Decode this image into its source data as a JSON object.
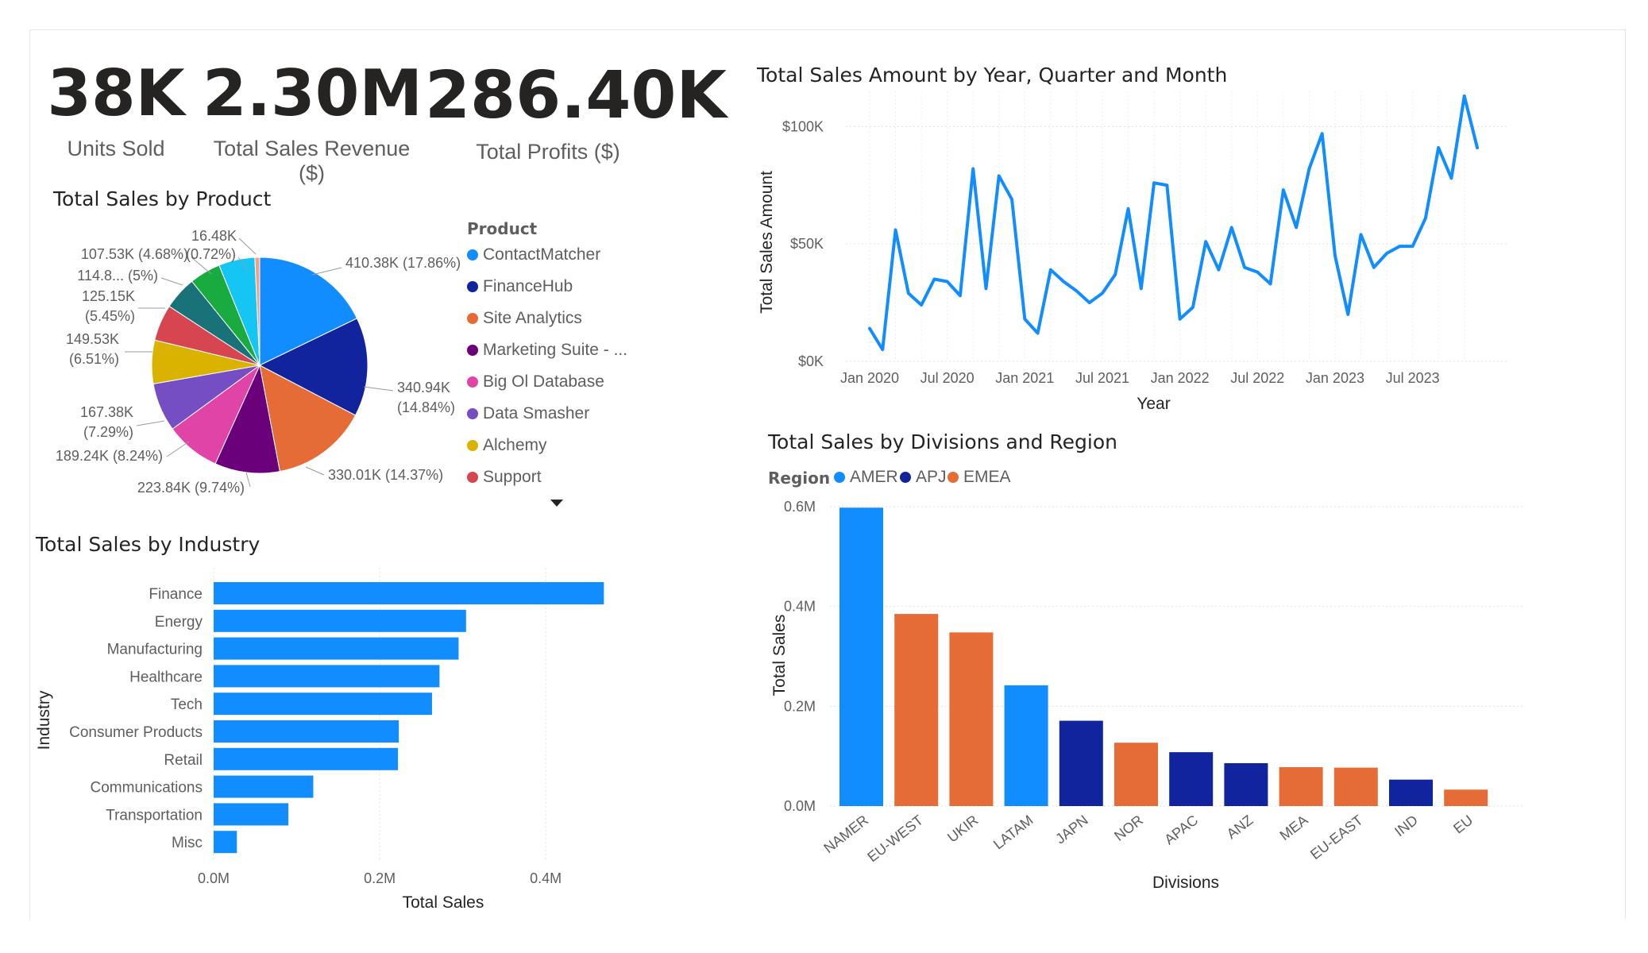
{
  "kpis": [
    {
      "value": "38K",
      "label": "Units Sold"
    },
    {
      "value": "2.30M",
      "label": "Total Sales Revenue ($)"
    },
    {
      "value": "286.40K",
      "label": "Total Profits ($)"
    }
  ],
  "colors": {
    "blue": "#118DFF",
    "navy": "#12239E",
    "orange": "#E66C37",
    "purple": "#6B007B",
    "pink": "#E044A7",
    "violet": "#744EC2",
    "yellow": "#D9B300",
    "red": "#D64550",
    "teal": "#197278",
    "green": "#1AAB40",
    "cyan": "#15C6F4",
    "salmon": "#F5A080"
  },
  "product_legend": {
    "title": "Product",
    "items": [
      {
        "label": "ContactMatcher",
        "color": "#118DFF"
      },
      {
        "label": "FinanceHub",
        "color": "#12239E"
      },
      {
        "label": "Site Analytics",
        "color": "#E66C37"
      },
      {
        "label": "Marketing Suite - ...",
        "color": "#6B007B"
      },
      {
        "label": "Big Ol Database",
        "color": "#E044A7"
      },
      {
        "label": "Data Smasher",
        "color": "#744EC2"
      },
      {
        "label": "Alchemy",
        "color": "#D9B300"
      },
      {
        "label": "Support",
        "color": "#D64550"
      }
    ]
  },
  "region_legend": {
    "title": "Region",
    "items": [
      {
        "label": "AMER",
        "color": "#118DFF"
      },
      {
        "label": "APJ",
        "color": "#12239E"
      },
      {
        "label": "EMEA",
        "color": "#E66C37"
      }
    ]
  },
  "chart_data": [
    {
      "type": "pie",
      "title": "Total Sales by Product",
      "values": [
        410.38,
        340.94,
        330.01,
        223.84,
        189.24,
        167.38,
        149.53,
        125.15,
        114.8,
        107.53,
        16.48
      ],
      "colors": [
        "#118DFF",
        "#12239E",
        "#E66C37",
        "#6B007B",
        "#E044A7",
        "#744EC2",
        "#D9B300",
        "#D64550",
        "#197278",
        "#1AAB40",
        "#15C6F4",
        "#F5A080"
      ],
      "labels": [
        {
          "lines": [
            "410.38K (17.86%)"
          ]
        },
        {
          "lines": [
            "340.94K",
            "(14.84%)"
          ]
        },
        {
          "lines": [
            "330.01K (14.37%)"
          ]
        },
        {
          "lines": [
            "223.84K (9.74%)"
          ]
        },
        {
          "lines": [
            "189.24K (8.24%)"
          ]
        },
        {
          "lines": [
            "167.38K",
            "(7.29%)"
          ]
        },
        {
          "lines": [
            "149.53K",
            "(6.51%)"
          ]
        },
        {
          "lines": [
            "125.15K",
            "(5.45%)"
          ]
        },
        {
          "lines": [
            "114.8... (5%)"
          ]
        },
        {
          "lines": [
            "107.53K (4.68%)"
          ]
        },
        {
          "lines": [
            "(0.72%)"
          ]
        },
        {
          "lines": [
            "16.48K"
          ]
        }
      ]
    },
    {
      "type": "line",
      "title": "Total Sales Amount by Year, Quarter and Month",
      "xlabel": "Year",
      "ylabel": "Total Sales Amount",
      "x_ticks": [
        "Jan 2020",
        "Jul 2020",
        "Jan 2021",
        "Jul 2021",
        "Jan 2022",
        "Jul 2022",
        "Jan 2023",
        "Jul 2023"
      ],
      "y_ticks": [
        "$0K",
        "$50K",
        "$100K"
      ],
      "ylim": [
        0,
        115000
      ],
      "x_start": "Jan 2020",
      "values": [
        14000,
        5000,
        56000,
        29000,
        24000,
        35000,
        34000,
        28000,
        82000,
        31000,
        79000,
        69000,
        18000,
        12000,
        39000,
        34000,
        30000,
        25000,
        29000,
        37000,
        65000,
        31000,
        76000,
        75000,
        18000,
        23000,
        51000,
        39000,
        57000,
        40000,
        38000,
        33000,
        73000,
        57000,
        82000,
        97000,
        45000,
        20000,
        54000,
        40000,
        46000,
        49000,
        49000,
        61000,
        91000,
        78000,
        113000,
        91000
      ],
      "color": "#118DFF"
    },
    {
      "type": "bar",
      "orientation": "horizontal",
      "title": "Total Sales by Industry",
      "xlabel": "Total Sales",
      "ylabel": "Industry",
      "categories": [
        "Finance",
        "Energy",
        "Manufacturing",
        "Healthcare",
        "Tech",
        "Consumer Products",
        "Retail",
        "Communications",
        "Transportation",
        "Misc"
      ],
      "values": [
        0.47,
        0.304,
        0.295,
        0.272,
        0.263,
        0.223,
        0.222,
        0.12,
        0.09,
        0.028
      ],
      "x_ticks": [
        "0.0M",
        "0.2M",
        "0.4M"
      ],
      "xlim": [
        0,
        0.55
      ],
      "color": "#118DFF"
    },
    {
      "type": "bar",
      "orientation": "vertical",
      "title": "Total Sales by Divisions and Region",
      "xlabel": "Divisions",
      "ylabel": "Total Sales",
      "categories": [
        "NAMER",
        "EU-WEST",
        "UKIR",
        "LATAM",
        "JAPN",
        "NOR",
        "APAC",
        "ANZ",
        "MEA",
        "EU-EAST",
        "IND",
        "EU"
      ],
      "values": [
        0.598,
        0.385,
        0.348,
        0.242,
        0.171,
        0.127,
        0.108,
        0.086,
        0.078,
        0.077,
        0.053,
        0.033
      ],
      "regions": [
        "AMER",
        "EMEA",
        "EMEA",
        "AMER",
        "APJ",
        "EMEA",
        "APJ",
        "APJ",
        "EMEA",
        "EMEA",
        "APJ",
        "EMEA"
      ],
      "y_ticks": [
        "0.0M",
        "0.2M",
        "0.4M",
        "0.6M"
      ],
      "ylim": [
        0,
        0.6
      ]
    }
  ]
}
